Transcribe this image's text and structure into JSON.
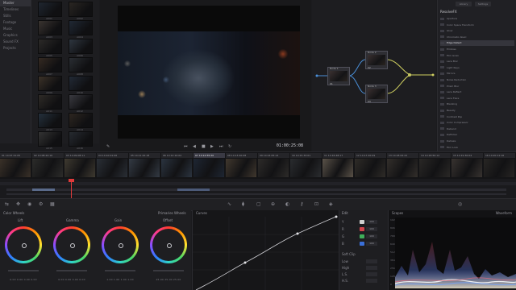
{
  "sidebar": {
    "items": [
      "Master",
      "Timelines",
      "Stills",
      "Footage",
      "Music",
      "Graphics",
      "Sound FX",
      "Projects"
    ],
    "selected": 0
  },
  "media_pool": {
    "clips": [
      "A001",
      "A002",
      "A003",
      "A004",
      "A005",
      "A006",
      "A007",
      "A008",
      "A009",
      "A010",
      "A011",
      "A012",
      "A013",
      "A014",
      "A015",
      "A016",
      "A017",
      "A018"
    ]
  },
  "viewer": {
    "timecode": "01:00:25:08",
    "controls": {
      "prev": "⏮",
      "back": "◀",
      "stop": "■",
      "play": "▶",
      "next": "⏭",
      "loop": "↻"
    }
  },
  "nodes": [
    {
      "num": "01",
      "label": "Node 1"
    },
    {
      "num": "02",
      "label": "Node 2"
    },
    {
      "num": "03",
      "label": "Node 3"
    }
  ],
  "fx_library": {
    "tabs": [
      "Library",
      "Settings"
    ],
    "title": "ResolveFX",
    "items": [
      "Aperture",
      "Color Space Transform",
      "Glow",
      "Chromatic Aberr.",
      "Edge Detect",
      "Emboss",
      "Film Grain",
      "Lens Blur",
      "Light Rays",
      "Mirrors",
      "Noise Reduction",
      "Prism Blur",
      "Lens Reflect",
      "Lens Flare",
      "Blanking",
      "Beauty",
      "Contrast Pop",
      "Color Compressor",
      "Deband",
      "Deflicker",
      "Dehaze",
      "Film Look"
    ],
    "selected": 4
  },
  "clip_strip": {
    "clips": [
      {
        "num": "01",
        "tc": "14:07:21:05",
        "codec": "H.264",
        "tone": "#3a3128"
      },
      {
        "num": "02",
        "tc": "14:08:22:10",
        "codec": "H.264",
        "tone": "#2c2c2a"
      },
      {
        "num": "03",
        "tc": "14:09:08:11",
        "codec": "H.264",
        "tone": "#3f3a30"
      },
      {
        "num": "04",
        "tc": "14:10:01:06",
        "codec": "H.264",
        "tone": "#2a2f36"
      },
      {
        "num": "05",
        "tc": "14:11:42:18",
        "codec": "H.264",
        "tone": "#333a44"
      },
      {
        "num": "06",
        "tc": "14:12:10:02",
        "codec": "H.264",
        "tone": "#2b3440"
      },
      {
        "num": "07",
        "tc": "14:12:55:20",
        "codec": "H.264",
        "tone": "#1e2633"
      },
      {
        "num": "08",
        "tc": "14:13:40:08",
        "codec": "H.264",
        "tone": "#41382e"
      },
      {
        "num": "09",
        "tc": "14:14:05:14",
        "codec": "H.264",
        "tone": "#2d2b29"
      },
      {
        "num": "10",
        "tc": "14:15:33:01",
        "codec": "H.264",
        "tone": "#2a2c2f"
      },
      {
        "num": "11",
        "tc": "14:16:48:17",
        "codec": "H.264",
        "tone": "#5a5248"
      },
      {
        "num": "12",
        "tc": "14:17:20:09",
        "codec": "H.264",
        "tone": "#2f2c28"
      },
      {
        "num": "13",
        "tc": "14:18:02:22",
        "codec": "H.264",
        "tone": "#332f2b"
      },
      {
        "num": "14",
        "tc": "14:18:50:12",
        "codec": "H.264",
        "tone": "#2a2826"
      },
      {
        "num": "15",
        "tc": "14:19:30:04",
        "codec": "H.264",
        "tone": "#383330"
      },
      {
        "num": "16",
        "tc": "14:20:11:16",
        "codec": "H.264",
        "tone": "#282624"
      }
    ],
    "selected": 6
  },
  "color_wheels": {
    "title": "Color Wheels",
    "mode": "Primaries Wheels",
    "wheels": [
      {
        "name": "Lift",
        "values": "0.00  0.00  0.00  0.00"
      },
      {
        "name": "Gamma",
        "values": "0.00  0.00  0.00  0.00"
      },
      {
        "name": "Gain",
        "values": "1.00  1.00  1.00  1.00"
      },
      {
        "name": "Offset",
        "values": "25.00  25.00  25.00"
      }
    ]
  },
  "curves": {
    "title": "Curves"
  },
  "edit_panel": {
    "title": "Edit",
    "rows": [
      {
        "label": "Y",
        "color": "#cfcfcf",
        "value": "100"
      },
      {
        "label": "R",
        "color": "#d0424b",
        "value": "100"
      },
      {
        "label": "G",
        "color": "#3fae5a",
        "value": "100"
      },
      {
        "label": "B",
        "color": "#3a6fd8",
        "value": "100"
      }
    ],
    "soft_clip": "Soft Clip",
    "clip_rows": [
      "Low",
      "High",
      "L.S.",
      "H.S."
    ]
  },
  "scopes": {
    "title": "Scopes",
    "mode": "Waveform",
    "scale": [
      "1023",
      "896",
      "768",
      "640",
      "512",
      "384",
      "256",
      "128",
      "0"
    ]
  },
  "colors": {
    "accent": "#d0424b",
    "playhead": "#e03a3a",
    "selection": "#35353c"
  }
}
